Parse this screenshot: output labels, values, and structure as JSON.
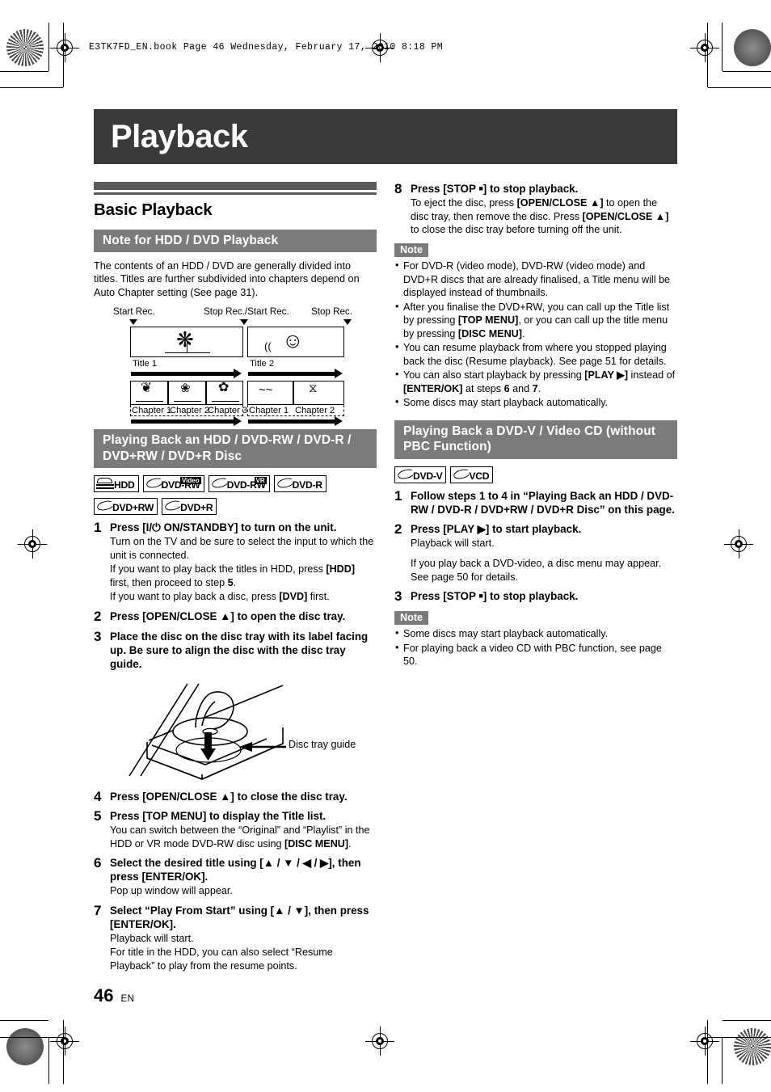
{
  "file_header": "E3TK7FD_EN.book  Page 46  Wednesday, February 17, 2010  8:18 PM",
  "chapter_title": "Playback",
  "section_title": "Basic Playback",
  "footer": {
    "page_number": "46",
    "language": "EN"
  },
  "colors": {
    "chapter_bar": "#3a3a3a",
    "rule": "#5a5a5a",
    "subhead_bg": "#7b7b7b",
    "note_badge_bg": "#7b7b7b",
    "text": "#000000"
  },
  "left_column": {
    "subhead_note_playback": "Note for HDD / DVD Playback",
    "intro": "The contents of an HDD / DVD are generally divided into titles. Titles are further subdivided into chapters depend on Auto Chapter setting (See page 31).",
    "diagram": {
      "labels": {
        "start_rec": "Start Rec.",
        "stop_start_rec": "Stop Rec./Start Rec.",
        "stop_rec": "Stop Rec."
      },
      "titles": [
        "Title 1",
        "Title 2"
      ],
      "chapters_title1": [
        "Chapter 1",
        "Chapter 2",
        "Chapter 3"
      ],
      "chapters_title2": [
        "Chapter 1",
        "Chapter 2"
      ]
    },
    "subhead_playing_back": "Playing Back an HDD / DVD-RW / DVD-R / DVD+RW / DVD+R Disc",
    "disc_icons_row1": [
      {
        "label": "HDD",
        "tag": "",
        "kind": "hdd"
      },
      {
        "label": "DVD-RW",
        "tag": "Video",
        "kind": "disc"
      },
      {
        "label": "DVD-RW",
        "tag": "VR",
        "kind": "disc"
      },
      {
        "label": "DVD-R",
        "tag": "",
        "kind": "disc"
      }
    ],
    "disc_icons_row2": [
      {
        "label": "DVD+RW",
        "tag": "",
        "kind": "disc"
      },
      {
        "label": "DVD+R",
        "tag": "",
        "kind": "disc"
      }
    ],
    "steps": [
      {
        "num": "1",
        "lead_html": "Press [<b>I</b>/⏻ <b>ON/STANDBY</b>] to turn on the unit.",
        "subs": [
          "Turn on the TV and be sure to select the input to which the unit is connected.",
          "If you want to play back the titles in HDD, press [HDD] first, then proceed to step 5.",
          "If you want to play back a disc, press [DVD] first."
        ]
      },
      {
        "num": "2",
        "lead_html": "Press [OPEN/CLOSE ▲] to open the disc tray.",
        "subs": []
      },
      {
        "num": "3",
        "lead_html": "Place the disc on the disc tray with its label facing up. Be sure to align the disc with the disc tray guide.",
        "subs": []
      },
      {
        "num": "4",
        "lead_html": "Press [OPEN/CLOSE ▲] to close the disc tray.",
        "subs": []
      },
      {
        "num": "5",
        "lead_html": "Press [TOP MENU] to display the Title list.",
        "subs": [
          "You can switch between the “Original” and “Playlist” in the HDD or VR mode DVD-RW disc using [DISC MENU]."
        ]
      },
      {
        "num": "6",
        "lead_html": "Select the desired title using [▲ / ▼ / ◀ / ▶], then press [ENTER/OK].",
        "subs": [
          "Pop up window will appear."
        ]
      },
      {
        "num": "7",
        "lead_html": "Select “Play From Start” using [▲ / ▼], then press [ENTER/OK].",
        "subs": [
          "Playback will start.",
          "For title in the HDD, you can also select “Resume Playback” to play from the resume points."
        ]
      }
    ],
    "tray_caption": "Disc tray guide"
  },
  "right_column": {
    "step8": {
      "num": "8",
      "lead": "Press [STOP ■] to stop playback.",
      "sub": "To eject the disc, press [OPEN/CLOSE ▲] to open the disc tray, then remove the disc. Press [OPEN/CLOSE ▲] to close the disc tray before turning off the unit."
    },
    "note_label_1": "Note",
    "notes_1": [
      "For DVD-R (video mode), DVD-RW (video mode) and DVD+R discs that are already finalised, a Title menu will be displayed instead of thumbnails.",
      "After you finalise the DVD+RW, you can call up the Title list by pressing [TOP MENU], or you can call up the title menu by pressing [DISC MENU].",
      "You can resume playback from where you stopped playing back the disc (Resume playback). See page 51 for details.",
      "You can also start playback by pressing [PLAY ▶] instead of [ENTER/OK] at steps 6 and 7.",
      "Some discs may start playback automatically."
    ],
    "subhead_dvdv": "Playing Back a DVD-V / Video CD (without PBC Function)",
    "disc_icons": [
      {
        "label": "DVD-V",
        "tag": "",
        "kind": "disc"
      },
      {
        "label": "VCD",
        "tag": "",
        "kind": "disc"
      }
    ],
    "steps": [
      {
        "num": "1",
        "lead": "Follow steps 1 to 4 in “Playing Back an HDD / DVD-RW / DVD-R / DVD+RW / DVD+R Disc” on this page.",
        "subs": []
      },
      {
        "num": "2",
        "lead": "Press [PLAY ▶] to start playback.",
        "subs": [
          "Playback will start.",
          "If you play back a DVD-video, a disc menu may appear. See page 50 for details."
        ]
      },
      {
        "num": "3",
        "lead": "Press [STOP ■] to stop playback.",
        "subs": []
      }
    ],
    "note_label_2": "Note",
    "notes_2": [
      "Some discs may start playback automatically.",
      "For playing back a video CD with PBC function, see page 50."
    ]
  }
}
